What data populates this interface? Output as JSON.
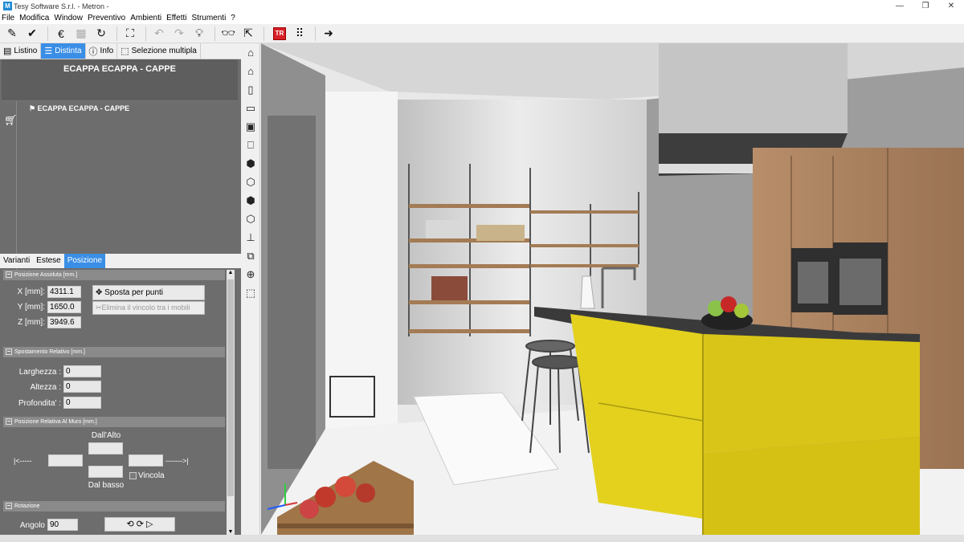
{
  "window": {
    "title": "Tesy Software S.r.l. - Metron -",
    "app_icon": "metron-app-icon"
  },
  "menu": [
    "File",
    "Modifica",
    "Window",
    "Preventivo",
    "Ambienti",
    "Effetti",
    "Strumenti",
    "?"
  ],
  "toolbar": {
    "icons": [
      "pencil-icon",
      "checkmark-icon",
      "euro-icon",
      "calculator-icon",
      "refresh-icon",
      "fullscreen-icon",
      "undo-icon",
      "redo-icon",
      "lightbulb-icon",
      "glasses-icon",
      "measure-icon",
      "tr-icon",
      "grid-icon",
      "arrow-right-icon"
    ],
    "tr_label": "TR"
  },
  "left_tabs": [
    {
      "label": "Listino",
      "icon": "list-book-icon"
    },
    {
      "label": "Distinta",
      "icon": "distinta-list-icon"
    },
    {
      "label": "Info",
      "icon": "info-icon"
    },
    {
      "label": "Selezione multipla",
      "icon": "multi-select-icon"
    }
  ],
  "distinta": {
    "header_title": "ECAPPA ECAPPA - CAPPE",
    "item_label": "ECAPPA ECAPPA - CAPPE"
  },
  "sub_tabs": [
    "Varianti",
    "Estese",
    "Posizione"
  ],
  "posizione": {
    "sec_assoluta": "Posizione Assoluta [mm.]",
    "x_label": "X [mm]:",
    "x_value": "4311.1",
    "y_label": "Y [mm]:",
    "y_value": "1650.0",
    "z_label": "Z [mm]:",
    "z_value": "3949.6",
    "sposta_label": "Sposta per punti",
    "elimina_label": "Elimina il vincolo tra i mobili",
    "sec_relativo": "Spostamento Relativo [mm.]",
    "larghezza_label": "Larghezza :",
    "larghezza_value": "0",
    "altezza_label": "Altezza :",
    "altezza_value": "0",
    "profondita_label": "Profondita' :",
    "profondita_value": "0",
    "sec_muro": "Posizione Relativa Al Muro [mm.]",
    "dall_alto": "Dall'Alto",
    "dal_basso": "Dal basso",
    "left_arrow": "|<-----",
    "right_arrow": "------->|",
    "vincola": "Vincola",
    "sec_rotazione": "Rotazione",
    "angolo_label": "Angolo",
    "angolo_value": "90"
  },
  "vertical_tools": [
    "home-icon",
    "house-outline-icon",
    "door-icon",
    "window-icon",
    "cabinet-icon",
    "bookmark-icon",
    "cube-iso-1-icon",
    "cube-iso-2-icon",
    "cube-iso-3-icon",
    "cube-iso-4-icon",
    "height-tool-icon",
    "frame-icon",
    "zoom-icon",
    "box-3d-icon"
  ],
  "colors": {
    "accent": "#3a8ee6",
    "panel": "#6d6d6d",
    "island": "#e6d31c",
    "tr_red": "#d72027"
  }
}
